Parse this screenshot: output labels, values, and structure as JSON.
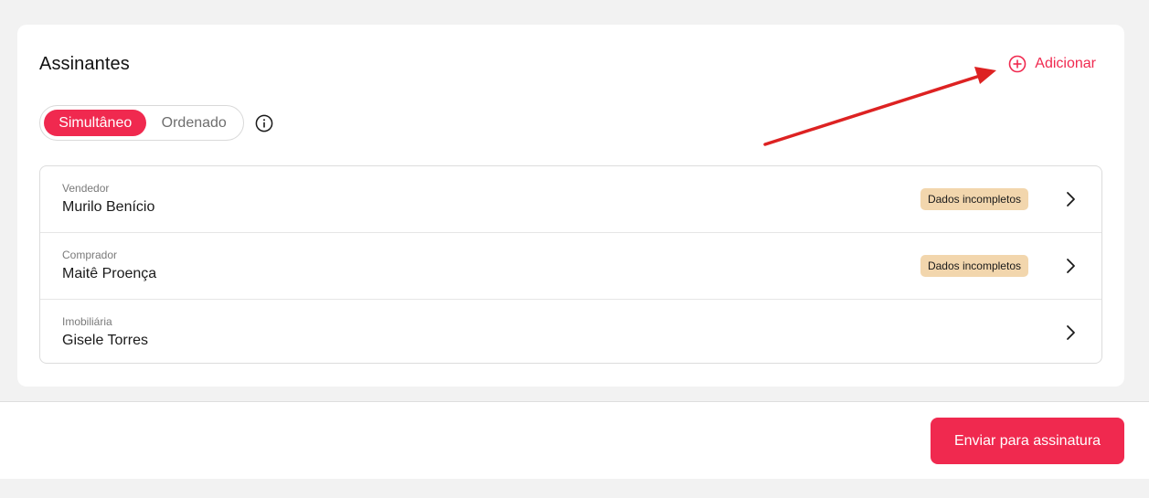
{
  "signers_section": {
    "title": "Assinantes",
    "add_label": "Adicionar",
    "mode_toggle": {
      "options": [
        "Simultâneo",
        "Ordenado"
      ],
      "selected": "Simultâneo"
    },
    "signers": [
      {
        "role": "Vendedor",
        "name": "Murilo Benício",
        "badge": "Dados incompletos"
      },
      {
        "role": "Comprador",
        "name": "Maitê Proença",
        "badge": "Dados incompletos"
      },
      {
        "role": "Imobiliária",
        "name": "Gisele Torres",
        "badge": ""
      }
    ]
  },
  "footer": {
    "submit_label": "Enviar para assinatura"
  },
  "colors": {
    "accent": "#f0294f",
    "badge_bg": "#f2d6ad",
    "annotation_arrow": "#dd2222"
  },
  "icons": {
    "add": "plus-circle-icon",
    "info": "info-circle-icon",
    "row": "chevron-right-icon"
  }
}
